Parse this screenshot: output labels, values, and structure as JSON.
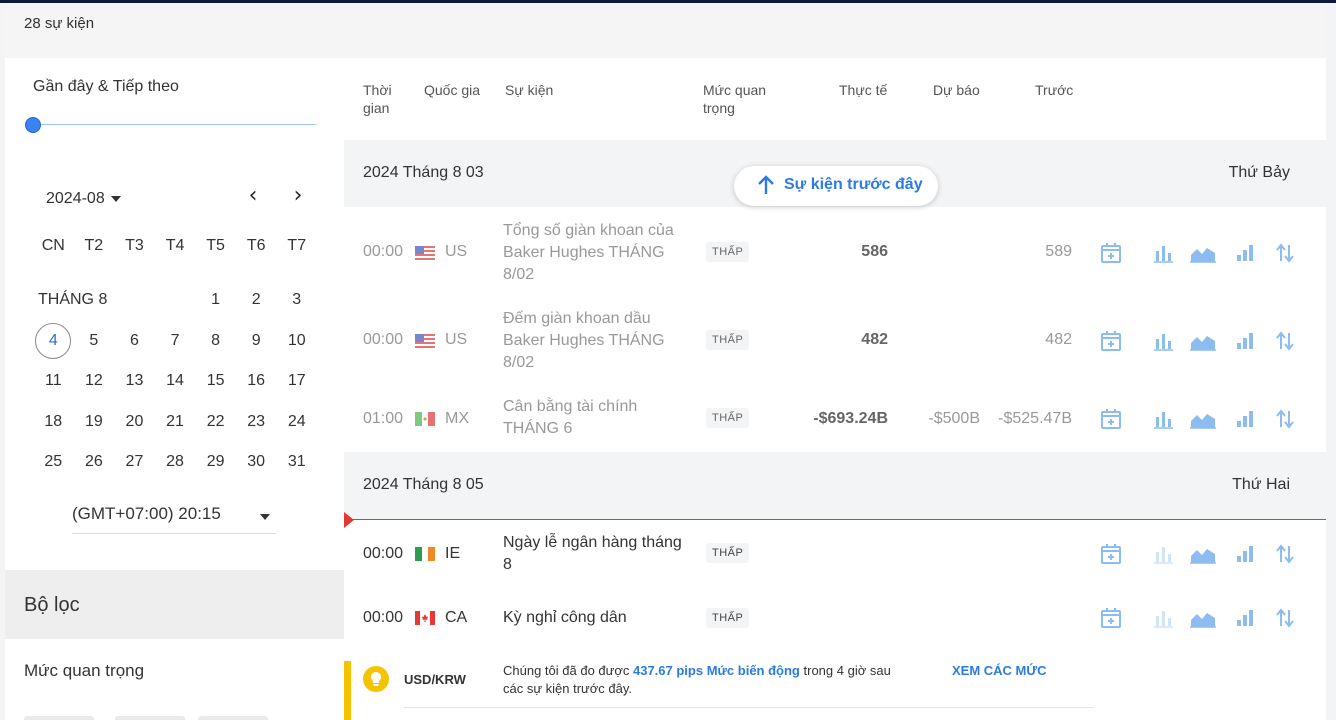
{
  "count_label": "28 sự kiện",
  "range": {
    "title": "Gần đây & Tiếp theo"
  },
  "calendar": {
    "month_value": "2024-08",
    "prev_arrow": "‹",
    "next_arrow": "›",
    "weekdays": [
      "CN",
      "T2",
      "T3",
      "T4",
      "T5",
      "T6",
      "T7"
    ],
    "month_label": "THÁNG 8",
    "row1": [
      "1",
      "2",
      "3"
    ],
    "row2": [
      "4",
      "5",
      "6",
      "7",
      "8",
      "9",
      "10"
    ],
    "row3": [
      "11",
      "12",
      "13",
      "14",
      "15",
      "16",
      "17"
    ],
    "row4": [
      "18",
      "19",
      "20",
      "21",
      "22",
      "23",
      "24"
    ],
    "row5": [
      "25",
      "26",
      "27",
      "28",
      "29",
      "30",
      "31"
    ],
    "today": "4"
  },
  "timezone": "(GMT+07:00) 20:15",
  "filter": {
    "title": "Bộ lọc",
    "importance_title": "Mức quan trọng"
  },
  "table": {
    "headers": {
      "time": "Thời gian",
      "country": "Quốc gia",
      "event": "Sự kiện",
      "importance": "Mức quan trọng",
      "actual": "Thực tế",
      "forecast": "Dự báo",
      "previous": "Trước"
    },
    "previous_events_button": "Sự kiện trước đây",
    "groups": [
      {
        "date": "2024 Tháng 8 03",
        "weekday": "Thứ Bảy",
        "events": [
          {
            "time": "00:00",
            "country": "US",
            "name": "Tổng số giàn khoan của Baker Hughes THÁNG 8/02",
            "importance": "THẤP",
            "actual": "586",
            "forecast": "",
            "previous": "589"
          },
          {
            "time": "00:00",
            "country": "US",
            "name": "Đếm giàn khoan dầu Baker Hughes THÁNG 8/02",
            "importance": "THẤP",
            "actual": "482",
            "forecast": "",
            "previous": "482"
          },
          {
            "time": "01:00",
            "country": "MX",
            "name": "Cân bằng tài chính THÁNG 6",
            "importance": "THẤP",
            "actual": "-$693.24B",
            "forecast": "-$500B",
            "previous": "-$525.47B"
          }
        ]
      },
      {
        "date": "2024 Tháng 8 05",
        "weekday": "Thứ Hai",
        "events": [
          {
            "time": "00:00",
            "country": "IE",
            "name": "Ngày lễ ngân hàng tháng 8",
            "importance": "THẤP",
            "actual": "",
            "forecast": "",
            "previous": ""
          },
          {
            "time": "00:00",
            "country": "CA",
            "name": "Kỳ nghỉ công dân",
            "importance": "THẤP",
            "actual": "",
            "forecast": "",
            "previous": ""
          }
        ]
      }
    ]
  },
  "promo": {
    "pair": "USD/KRW",
    "text_before": "Chúng tôi đã đo được ",
    "highlight": "437.67 pips Mức biến động",
    "text_after": " trong 4 giờ sau các sự kiện trước đây.",
    "cta": "XEM CÁC MỨC"
  },
  "colors": {
    "accent": "#2c7be5",
    "icon": "#8cbcf0",
    "now_line": "#e53935",
    "promo": "#f5c400"
  }
}
